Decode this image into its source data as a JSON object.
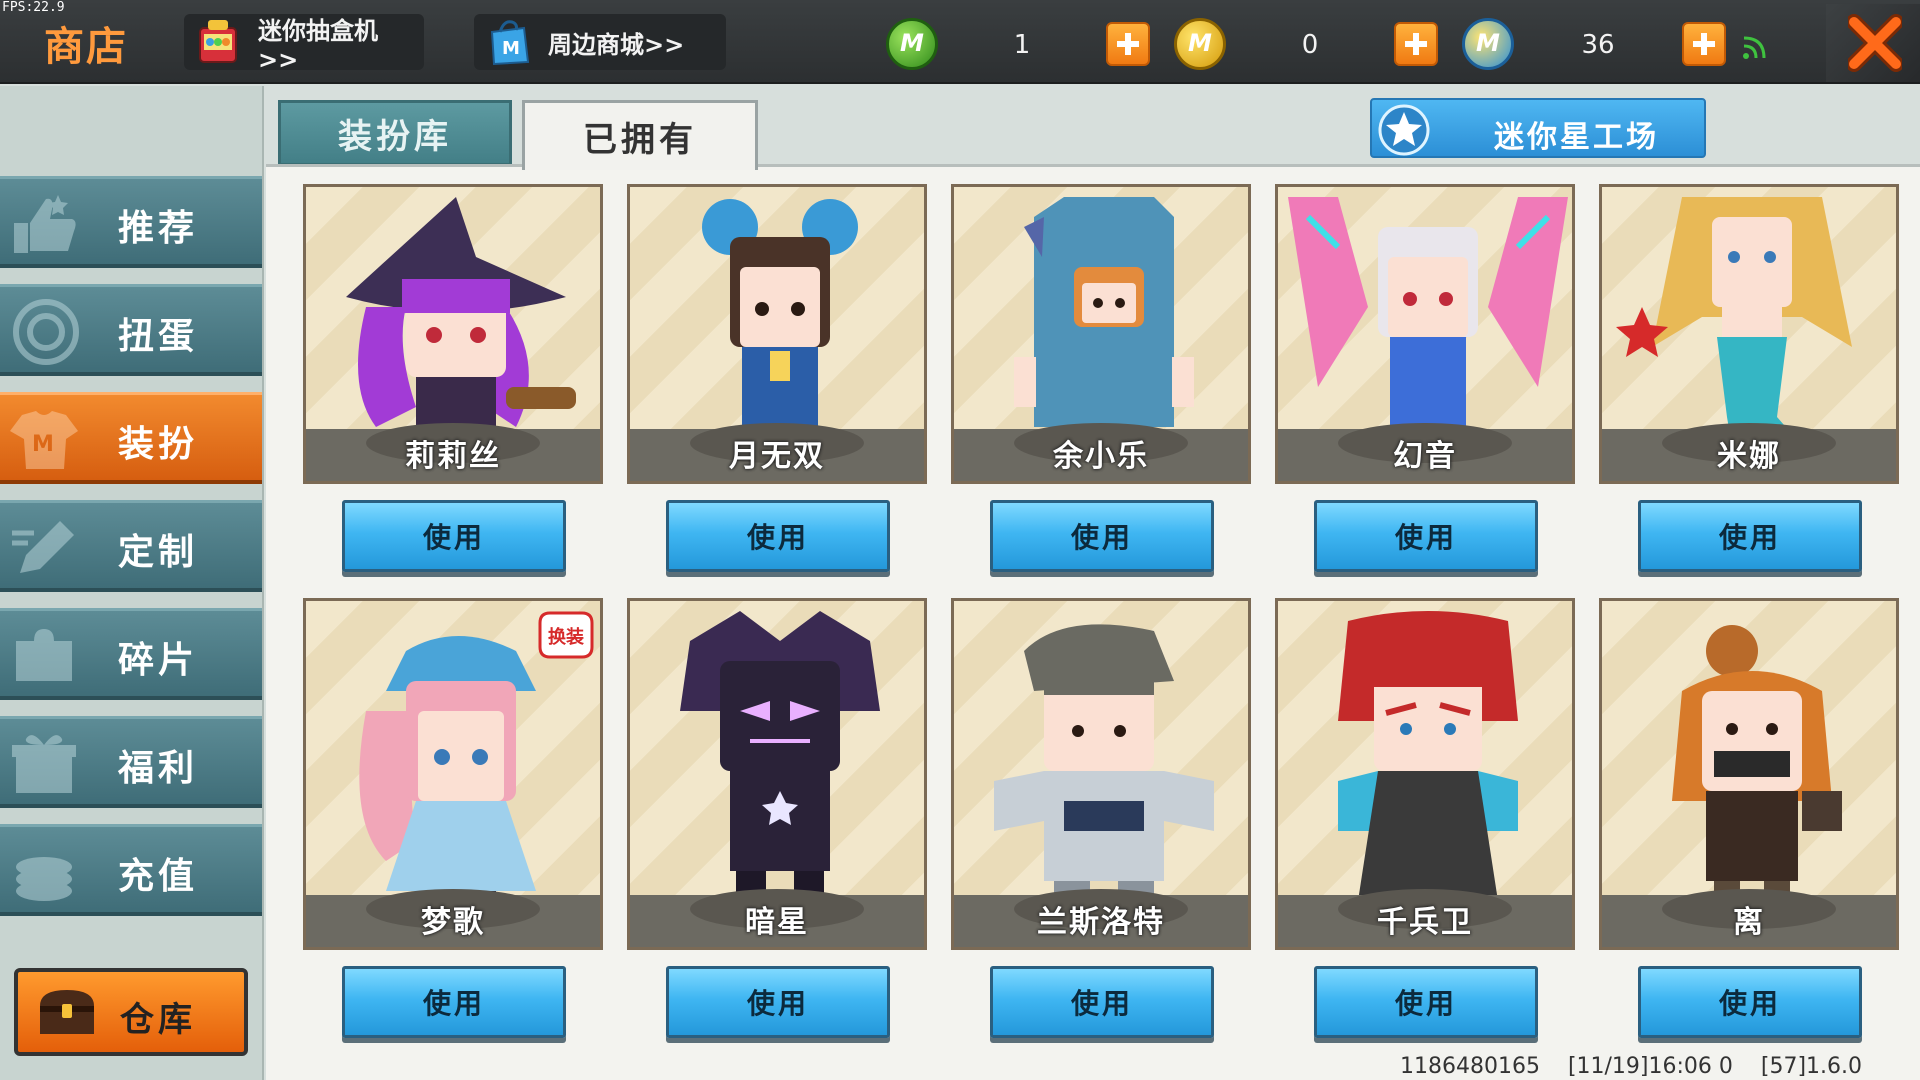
{
  "fps": "FPS:22.9",
  "header": {
    "title": "商店",
    "gacha_link": "迷你抽盒机>>",
    "mall_link": "周边商城>>",
    "currencies": [
      {
        "icon": "mini-bean-green-icon",
        "value": "1",
        "color": "#3a9a22"
      },
      {
        "icon": "mini-coin-gold-icon",
        "value": "0",
        "color": "#e0a812"
      },
      {
        "icon": "mini-point-blue-icon",
        "value": "36",
        "color": "#2a8ed8"
      }
    ]
  },
  "sidebar": {
    "items": [
      {
        "label": "推荐",
        "icon": "thumbs-up-icon"
      },
      {
        "label": "扭蛋",
        "icon": "gacha-egg-icon"
      },
      {
        "label": "装扮",
        "icon": "shirt-icon",
        "active": true
      },
      {
        "label": "定制",
        "icon": "pencil-icon"
      },
      {
        "label": "碎片",
        "icon": "puzzle-piece-icon"
      },
      {
        "label": "福利",
        "icon": "gift-icon"
      },
      {
        "label": "充值",
        "icon": "coin-stack-icon"
      }
    ],
    "warehouse": "仓库"
  },
  "tabs": {
    "library": "装扮库",
    "owned": "已拥有",
    "active": "owned"
  },
  "workshop": "迷你星工场",
  "skins": [
    {
      "name": "莉莉丝",
      "action": "使用",
      "hair": "#a23bd6",
      "outfit": "#3a2a4a"
    },
    {
      "name": "月无双",
      "action": "使用",
      "hair": "#4a3328",
      "outfit": "#2b5ea8"
    },
    {
      "name": "余小乐",
      "action": "使用",
      "hair": "#e38b3d",
      "outfit": "#4f93b8"
    },
    {
      "name": "幻音",
      "action": "使用",
      "hair": "#e9e6ec",
      "outfit": "#3d6ed8"
    },
    {
      "name": "米娜",
      "action": "使用",
      "hair": "#e8b956",
      "outfit": "#35b6c4"
    },
    {
      "name": "梦歌",
      "action": "使用",
      "hair": "#f1a6b8",
      "outfit": "#9fd0ec",
      "badge": "换装"
    },
    {
      "name": "暗星",
      "action": "使用",
      "hair": "#3a2a52",
      "outfit": "#2a2238"
    },
    {
      "name": "兰斯洛特",
      "action": "使用",
      "hair": "#6a6a62",
      "outfit": "#c7cfd6"
    },
    {
      "name": "千兵卫",
      "action": "使用",
      "hair": "#c42a2a",
      "outfit": "#3a3a3a"
    },
    {
      "name": "离",
      "action": "使用",
      "hair": "#d77a2a",
      "outfit": "#3a2a22"
    }
  ],
  "footer": "1186480165    [11/19]16:06 0    [57]1.6.0"
}
